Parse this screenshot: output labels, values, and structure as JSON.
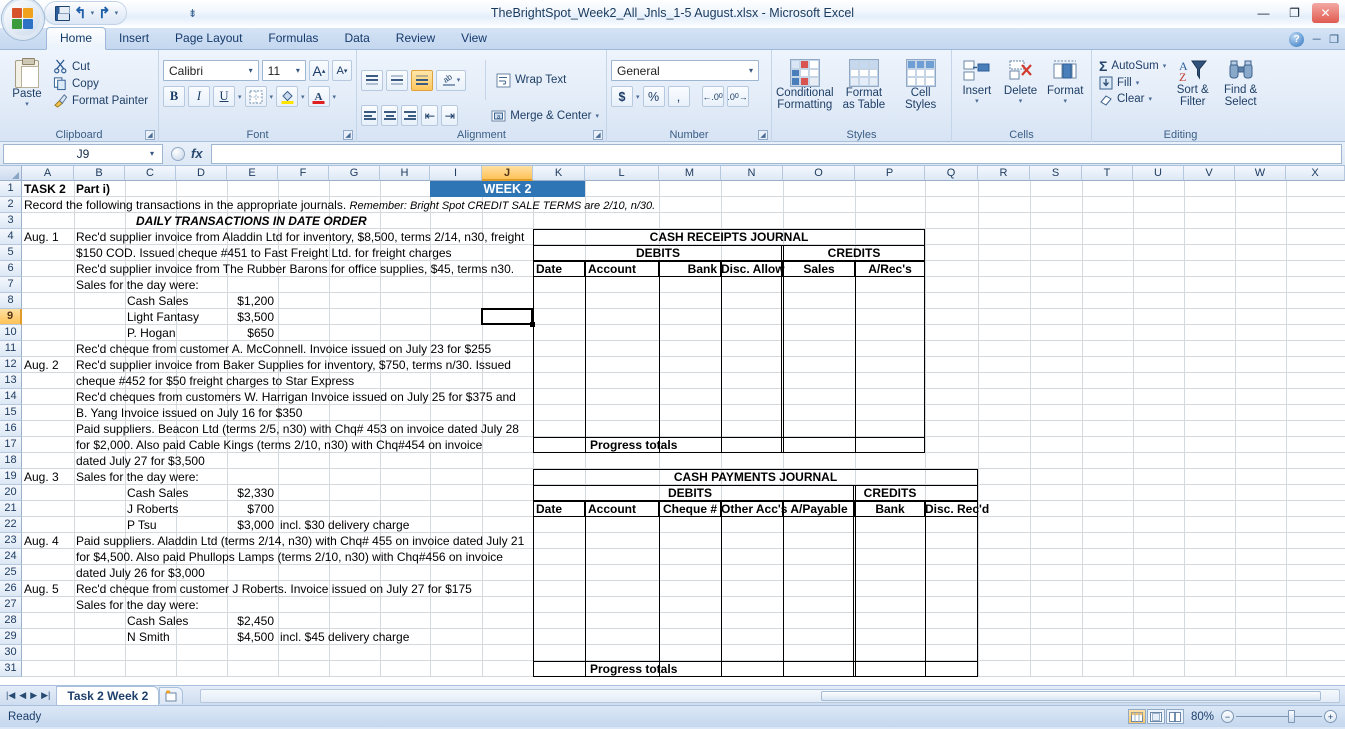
{
  "window": {
    "title": "TheBrightSpot_Week2_All_Jnls_1-5 August.xlsx  -  Microsoft Excel",
    "minimize": "—",
    "restore": "❐",
    "close": "✕"
  },
  "quick_access": {
    "save": "save-icon",
    "undo": "↰",
    "redo": "↱",
    "customize": "⇟"
  },
  "tabs": [
    {
      "label": "Home",
      "active": true
    },
    {
      "label": "Insert",
      "active": false
    },
    {
      "label": "Page Layout",
      "active": false
    },
    {
      "label": "Formulas",
      "active": false
    },
    {
      "label": "Data",
      "active": false
    },
    {
      "label": "Review",
      "active": false
    },
    {
      "label": "View",
      "active": false
    }
  ],
  "ribbon": {
    "clipboard": {
      "group_label": "Clipboard",
      "paste": "Paste",
      "cut": "Cut",
      "copy": "Copy",
      "format_painter": "Format Painter"
    },
    "font": {
      "group_label": "Font",
      "font_name": "Calibri",
      "font_size": "11",
      "grow": "A",
      "shrink": "A",
      "bold": "B",
      "italic": "I",
      "underline": "U"
    },
    "alignment": {
      "group_label": "Alignment",
      "wrap_text": "Wrap Text",
      "merge_center": "Merge & Center"
    },
    "number": {
      "group_label": "Number",
      "format": "General",
      "currency": "$",
      "percent": "%",
      "comma": ",",
      "inc_dec": ".00",
      "dec_dec": ".0"
    },
    "styles": {
      "group_label": "Styles",
      "conditional_formatting": "Conditional\nFormatting",
      "conditional_formatting_l1": "Conditional",
      "conditional_formatting_l2": "Formatting",
      "format_as_table_l1": "Format",
      "format_as_table_l2": "as Table",
      "cell_styles_l1": "Cell",
      "cell_styles_l2": "Styles"
    },
    "cells": {
      "group_label": "Cells",
      "insert": "Insert",
      "delete": "Delete",
      "format": "Format"
    },
    "editing": {
      "group_label": "Editing",
      "autosum": "AutoSum",
      "fill": "Fill",
      "clear": "Clear",
      "sort_filter_l1": "Sort &",
      "sort_filter_l2": "Filter",
      "find_select_l1": "Find &",
      "find_select_l2": "Select"
    }
  },
  "formula_bar": {
    "name_box": "J9",
    "fx": "fx",
    "formula": ""
  },
  "grid": {
    "columns": [
      "A",
      "B",
      "C",
      "D",
      "E",
      "F",
      "G",
      "H",
      "I",
      "J",
      "K",
      "L",
      "M",
      "N",
      "O",
      "P",
      "Q",
      "R",
      "S",
      "T",
      "U",
      "V",
      "W",
      "X"
    ],
    "selected_column": "J",
    "selected_row": 9,
    "rows": [
      1,
      2,
      3,
      4,
      5,
      6,
      7,
      8,
      9,
      10,
      11,
      12,
      13,
      14,
      15,
      16,
      17,
      18,
      19,
      20,
      21,
      22,
      23,
      24,
      25,
      26,
      27,
      28,
      29,
      30,
      31
    ],
    "week_banner": "WEEK 2",
    "cells": {
      "A1": "TASK 2",
      "B1": "Part i)",
      "A2": "Record the following transactions in the appropriate journals.",
      "A2_italic": "Remember: Bright Spot CREDIT SALE TERMS are 2/10, n/30.",
      "B3": "DAILY TRANSACTIONS IN DATE ORDER",
      "A4": "Aug. 1",
      "B4": "Rec'd supplier invoice from Aladdin Ltd for inventory, $8,500, terms 2/14, n30, freight",
      "B5": "$150 COD. Issued cheque #451 to Fast Freight Ltd. for freight charges",
      "B6": "Rec'd supplier invoice from The Rubber Barons for office supplies, $45, terms n30.",
      "B7": "Sales for the day were:",
      "C8": "Cash Sales",
      "E8": "$1,200",
      "C9": "Light Fantasy",
      "E9": "$3,500",
      "C10": "P. Hogan",
      "E10": "$650",
      "B11": "Rec'd cheque from customer A. McConnell. Invoice issued on July 23 for $255",
      "A12": "Aug. 2",
      "B12": "Rec'd supplier invoice from Baker Supplies for inventory, $750, terms n/30. Issued",
      "B13": "cheque #452 for $50 freight charges to Star Express",
      "B14": "Rec'd cheques from customers W. Harrigan Invoice issued on July 25 for $375 and",
      "B15": "B. Yang Invoice issued on July 16 for $350",
      "B16": "Paid suppliers. Beacon Ltd (terms 2/5, n30) with Chq# 453 on invoice dated July 28",
      "B17": "for $2,000. Also paid Cable Kings (terms 2/10, n30) with Chq#454 on invoice",
      "B18": "dated July 27 for $3,500",
      "A19": "Aug. 3",
      "B19": "Sales for the day were:",
      "C20": "Cash Sales",
      "E20": "$2,330",
      "C21": "J Roberts",
      "E21": "$700",
      "C22": "P Tsu",
      "E22": "$3,000",
      "F22": "incl. $30 delivery charge",
      "A23": "Aug. 4",
      "B23": "Paid suppliers. Aladdin Ltd (terms 2/14, n30) with Chq# 455 on invoice dated July 21",
      "B24": "for $4,500. Also paid Phullops Lamps (terms 2/10, n30) with Chq#456 on invoice",
      "B25": "dated July 26 for $3,000",
      "A26": "Aug. 5",
      "B26": "Rec'd cheque from customer J Roberts. Invoice issued on July 27 for $175",
      "B27": "Sales for the day were:",
      "C28": "Cash Sales",
      "E28": "$2,450",
      "C29": "N Smith",
      "E29": "$4,500",
      "F29": "incl. $45 delivery charge"
    },
    "cash_receipts_journal": {
      "title": "CASH RECEIPTS JOURNAL",
      "debits_label": "DEBITS",
      "credits_label": "CREDITS",
      "headers": [
        "Date",
        "Account",
        "Bank",
        "Disc. Allow",
        "Sales",
        "A/Rec's"
      ],
      "progress_totals": "Progress totals"
    },
    "cash_payments_journal": {
      "title": "CASH PAYMENTS JOURNAL",
      "debits_label": "DEBITS",
      "credits_label": "CREDITS",
      "headers": [
        "Date",
        "Account",
        "Cheque #",
        "Other Acc's",
        "A/Payable",
        "Bank",
        "Disc. Rec'd"
      ],
      "progress_totals": "Progress totals"
    }
  },
  "sheet_tabs": {
    "first": "|◀",
    "prev": "◀",
    "next": "▶",
    "last": "▶|",
    "sheets": [
      {
        "label": "Task 2 Week 2",
        "active": true
      }
    ],
    "new_sheet": "new-sheet-icon"
  },
  "status_bar": {
    "status": "Ready",
    "zoom": "80%",
    "zoom_out": "−",
    "zoom_in": "+",
    "views": [
      "normal-view",
      "page-layout-view",
      "page-break-view"
    ]
  }
}
